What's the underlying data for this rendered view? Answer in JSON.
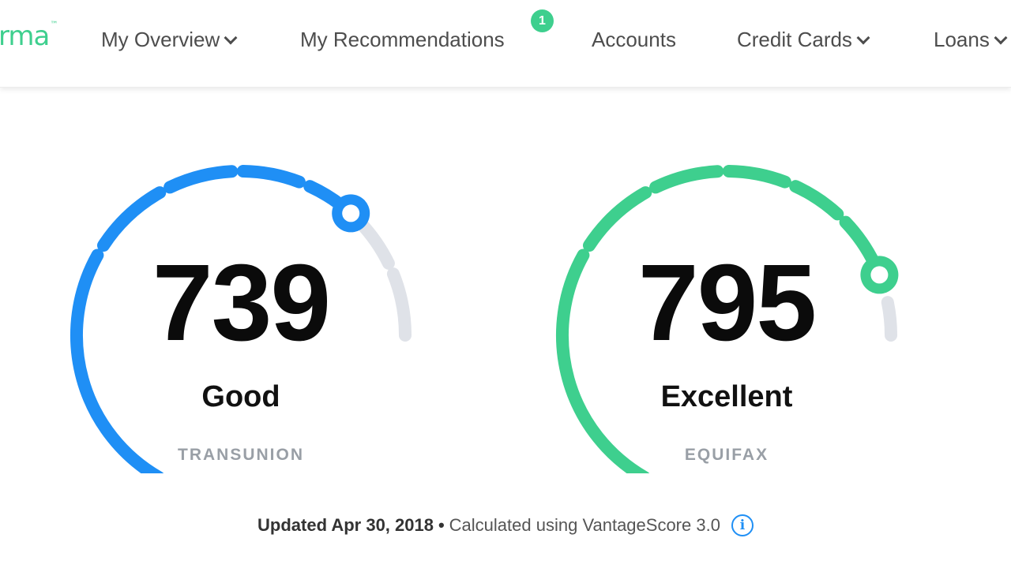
{
  "brand": {
    "logo_text": "rma",
    "accent_color": "#3ecf8e"
  },
  "nav": {
    "items": [
      {
        "label": "My Overview",
        "has_dropdown": true
      },
      {
        "label": "My Recommendations",
        "badge": "1"
      },
      {
        "label": "Accounts"
      },
      {
        "label": "Credit Cards",
        "has_dropdown": true
      },
      {
        "label": "Loans",
        "has_dropdown": true
      }
    ]
  },
  "scores": [
    {
      "score": "739",
      "rating": "Good",
      "bureau": "TRANSUNION",
      "color": "#1f8ff5",
      "level": 0.8
    },
    {
      "score": "795",
      "rating": "Excellent",
      "bureau": "EQUIFAX",
      "color": "#3ecf8e",
      "level": 0.91
    }
  ],
  "gauge_track_color": "#dfe2e8",
  "footer": {
    "updated": "Updated Apr 30, 2018",
    "separator": "•",
    "calc": "Calculated using VantageScore 3.0",
    "info_icon": "info-icon"
  }
}
